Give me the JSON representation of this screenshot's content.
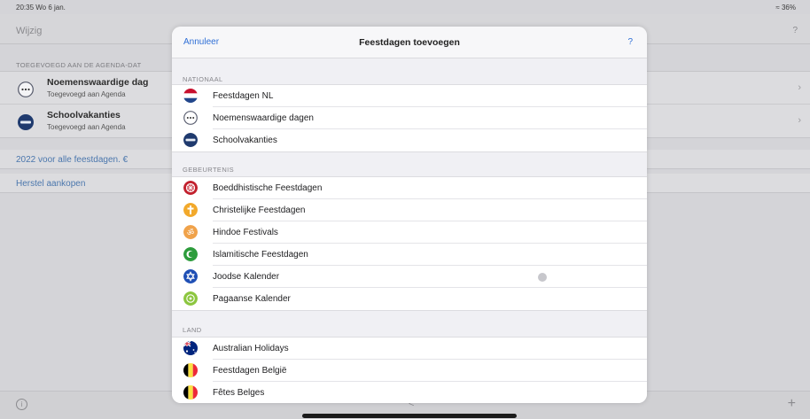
{
  "status_bar": {
    "time": "20:35  Wo 6 jan.",
    "battery": "36%"
  },
  "background": {
    "nav": {
      "edit_label": "Wijzig",
      "help_label": "?"
    },
    "section_label": "TOEGEVOEGD AAN DE AGENDA-DAT",
    "rows": [
      {
        "title": "Noemenswaardige dag",
        "subtitle": "Toegevoegd aan Agenda",
        "icon": "dots-icon"
      },
      {
        "title": "Schoolvakanties",
        "subtitle": "Toegevoegd aan Agenda",
        "icon": "school-icon"
      }
    ],
    "promo_link": "2022 voor alle feestdagen. €",
    "restore_link": "Herstel aankopen",
    "bottom": {
      "info_label": "i",
      "share_label": "<",
      "plus_label": "+"
    }
  },
  "modal": {
    "cancel_label": "Annuleer",
    "title": "Feestdagen toevoegen",
    "help_label": "?",
    "sections": [
      {
        "label": "NATIONAAL",
        "items": [
          {
            "label": "Feestdagen NL",
            "icon": "netherlands-flag-icon"
          },
          {
            "label": "Noemenswaardige dagen",
            "icon": "dots-icon"
          },
          {
            "label": "Schoolvakanties",
            "icon": "school-icon"
          }
        ]
      },
      {
        "label": "GEBEURTENIS",
        "items": [
          {
            "label": "Boeddhistische Feestdagen",
            "icon": "dharma-wheel-icon"
          },
          {
            "label": "Christelijke Feestdagen",
            "icon": "cross-icon"
          },
          {
            "label": "Hindoe Festivals",
            "icon": "om-icon"
          },
          {
            "label": "Islamitische Feestdagen",
            "icon": "crescent-icon"
          },
          {
            "label": "Joodse Kalender",
            "icon": "star-of-david-icon"
          },
          {
            "label": "Pagaanse Kalender",
            "icon": "pagan-icon"
          }
        ]
      },
      {
        "label": "LAND",
        "items": [
          {
            "label": "Australian Holidays",
            "icon": "australia-flag-icon"
          },
          {
            "label": "Feestdagen België",
            "icon": "belgium-flag-icon"
          },
          {
            "label": "Fêtes Belges",
            "icon": "belgium-flag-icon"
          }
        ]
      }
    ]
  },
  "colors": {
    "accent": "#2f6fd6",
    "link": "#4b77ad"
  }
}
